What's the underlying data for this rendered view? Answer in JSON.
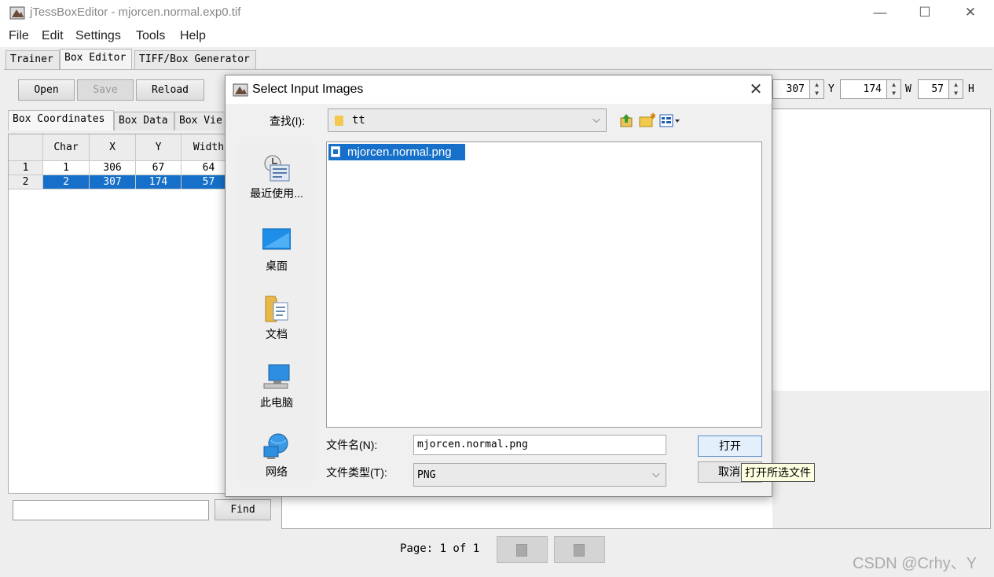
{
  "window": {
    "title": "jTessBoxEditor - mjorcen.normal.exp0.tif",
    "minimize": "—",
    "maximize": "☐",
    "close": "✕"
  },
  "menu": [
    "File",
    "Edit",
    "Settings",
    "Tools",
    "Help"
  ],
  "tabs": [
    "Trainer",
    "Box Editor",
    "TIFF/Box Generator"
  ],
  "toolbar": {
    "open": "Open",
    "save": "Save",
    "reload": "Reload"
  },
  "spinners": {
    "x_value": "307",
    "y_label": "Y",
    "y_value": "174",
    "w_label": "W",
    "w_value": "57",
    "h_label": "H"
  },
  "subtabs": [
    "Box Coordinates",
    "Box Data",
    "Box Vie"
  ],
  "table": {
    "columns": [
      "Char",
      "X",
      "Y",
      "Width"
    ],
    "rows": [
      {
        "num": "1",
        "char": "1",
        "x": "306",
        "y": "67",
        "width": "64"
      },
      {
        "num": "2",
        "char": "2",
        "x": "307",
        "y": "174",
        "width": "57"
      }
    ]
  },
  "find": {
    "value": "",
    "button": "Find"
  },
  "pager": {
    "text": "Page: 1 of 1"
  },
  "dialog": {
    "title": "Select Input Images",
    "look_in_label": "查找(I):",
    "look_in_value": "tt",
    "places": [
      "最近使用...",
      "桌面",
      "文档",
      "此电脑",
      "网络"
    ],
    "files": [
      "mjorcen.normal.png"
    ],
    "filename_label": "文件名(N):",
    "filename_value": "mjorcen.normal.png",
    "filetype_label": "文件类型(T):",
    "filetype_value": "PNG",
    "open_button": "打开",
    "cancel_button": "取消",
    "tooltip": "打开所选文件"
  },
  "watermark": "CSDN @Crhy、Y",
  "colors": {
    "selection": "#1670c9",
    "dialog_bg": "#f0f0f0"
  }
}
